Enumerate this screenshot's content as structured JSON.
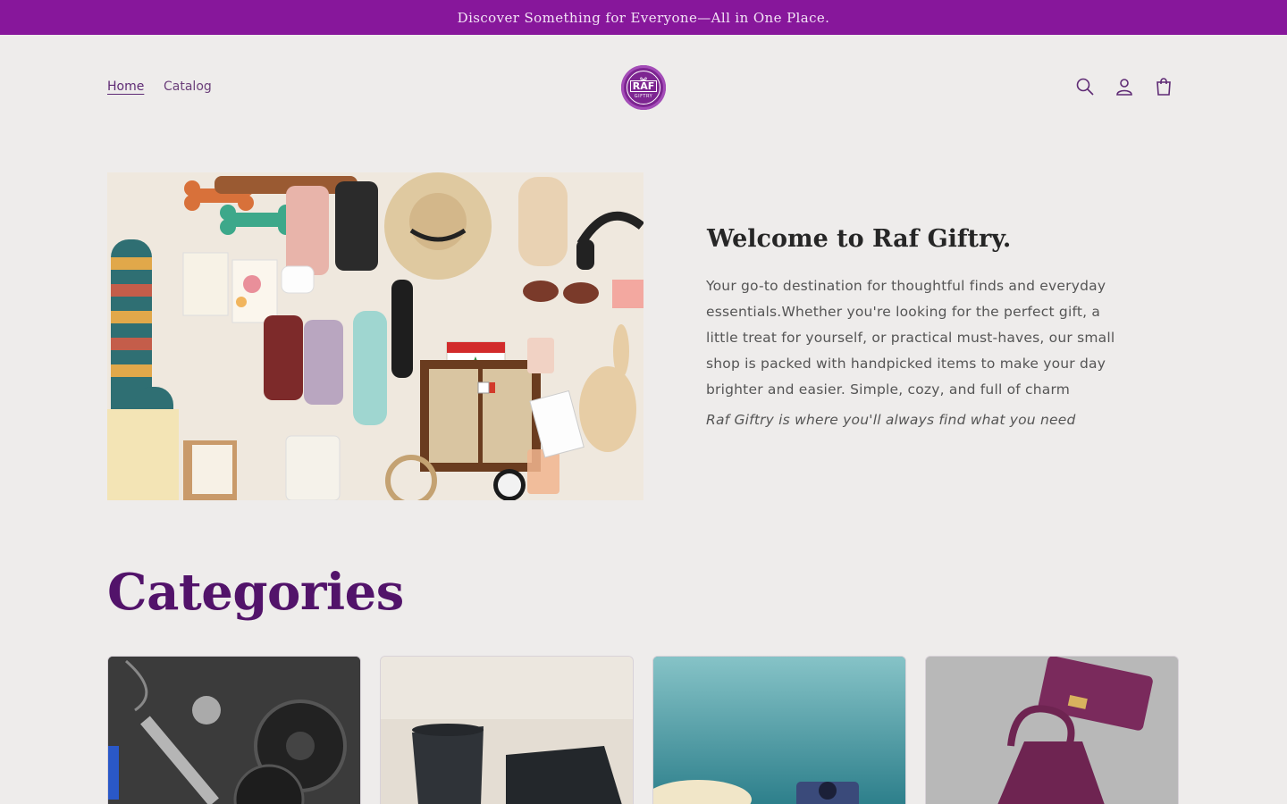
{
  "announcement": {
    "text": "Discover Something for Everyone—All in One Place."
  },
  "nav": {
    "items": [
      {
        "label": "Home"
      },
      {
        "label": "Catalog"
      }
    ]
  },
  "logo": {
    "top": "RAF",
    "bottom": "GIFTRY"
  },
  "header_icons": [
    "search-icon",
    "account-icon",
    "cart-icon"
  ],
  "hero": {
    "title": "Welcome to Raf Giftry.",
    "body": "Your go-to destination for thoughtful finds and everyday essentials.Whether you're looking for the perfect gift, a little treat for yourself, or practical must-haves, our small shop is packed with handpicked items to make your day brighter and easier. Simple, cozy, and full of charm",
    "tagline": "Raf Giftry is where you'll always find what you need"
  },
  "categories": {
    "title": "Categories",
    "cards": [
      {
        "image": "fitness-weights"
      },
      {
        "image": "black-cups"
      },
      {
        "image": "beach-camera"
      },
      {
        "image": "purple-handbag"
      }
    ]
  },
  "colors": {
    "announcement_bg": "#87179b",
    "page_bg": "#eeeceb",
    "heading_purple": "#52136a",
    "nav_text": "#6b3f7a"
  }
}
